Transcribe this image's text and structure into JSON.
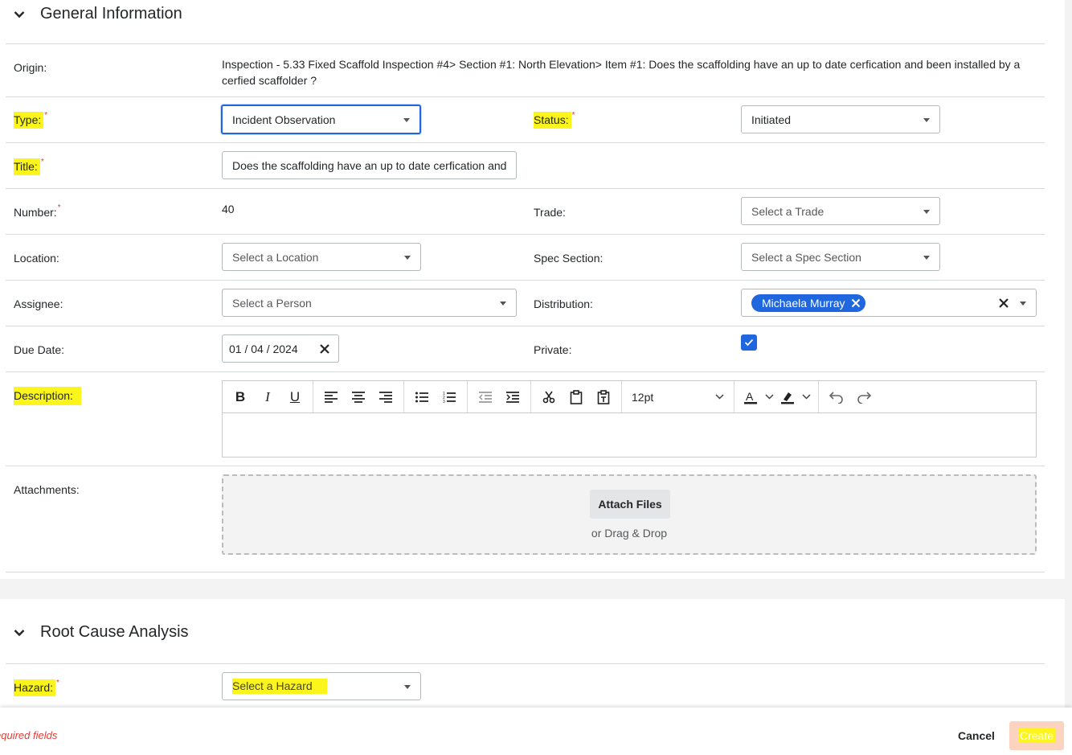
{
  "general": {
    "title": "General Information",
    "origin": {
      "label": "Origin:",
      "value": "Inspection - 5.33 Fixed Scaffold Inspection #4> Section #1: North Elevation> Item #1: Does the scaffolding have an up to date cerfication and been installed by a cerfied scaffolder ?"
    },
    "type": {
      "label": "Type:",
      "value": "Incident Observation"
    },
    "status": {
      "label": "Status:",
      "value": "Initiated"
    },
    "title_field": {
      "label": "Title:",
      "value": "Does the scaffolding have an up to date cerfication and"
    },
    "number": {
      "label": "Number:",
      "value": "40"
    },
    "trade": {
      "label": "Trade:",
      "placeholder": "Select a Trade"
    },
    "location": {
      "label": "Location:",
      "placeholder": "Select a Location"
    },
    "spec_section": {
      "label": "Spec Section:",
      "placeholder": "Select a Spec Section"
    },
    "assignee": {
      "label": "Assignee:",
      "placeholder": "Select a Person"
    },
    "distribution": {
      "label": "Distribution:",
      "chip": "Michaela Murray"
    },
    "due_date": {
      "label": "Due Date:",
      "value": "01 / 04 / 2024"
    },
    "private": {
      "label": "Private:",
      "checked": true
    },
    "description": {
      "label": "Description:",
      "font_size": "12pt"
    },
    "attachments": {
      "label": "Attachments:",
      "button": "Attach Files",
      "drag_text": "or Drag & Drop"
    }
  },
  "root_cause": {
    "title": "Root Cause Analysis",
    "hazard": {
      "label": "Hazard:",
      "placeholder": "Select a Hazard"
    }
  },
  "footer": {
    "required_note": "equired fields",
    "cancel": "Cancel",
    "create": "Create"
  },
  "required_mark": "*",
  "colors": {
    "primary": "#2066df",
    "highlight": "#fcf51c",
    "required": "#d9403a",
    "create_button": "#fbd3bf"
  }
}
